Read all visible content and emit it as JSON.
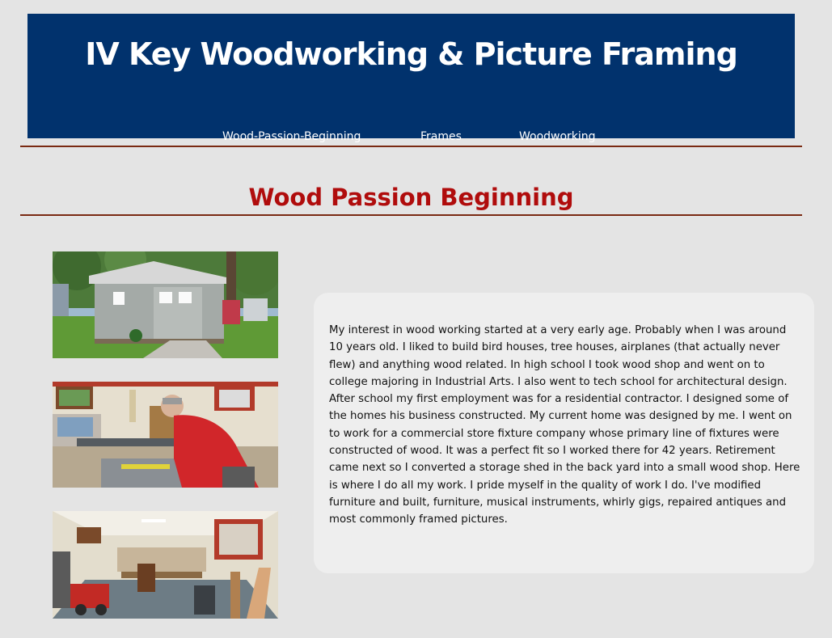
{
  "site": {
    "title": "IV Key Woodworking & Picture Framing"
  },
  "nav": {
    "items": [
      {
        "label": "Wood-Passion-Beginning"
      },
      {
        "label": "Frames"
      },
      {
        "label": "Woodworking"
      }
    ]
  },
  "page": {
    "title": "Wood Passion Beginning",
    "body": "My interest in wood working started at a very early age. Probably when I was around 10 years old. I liked to build bird houses, tree houses, airplanes (that actually never flew) and anything wood related. In high school I took wood shop and went on to college majoring in Industrial Arts. I also went to tech school for architectural design. After school my first employment was for a residential contractor. I designed some of the homes his business constructed. My current home was designed by me. I went on to work for a commercial store fixture company whose primary line of fixtures were constructed of wood. It was a perfect fit so I worked there for 42 years. Retirement came next so I converted a storage shed in the back yard into a small wood shop. Here is where I do all my work. I pride myself in the quality of work I do. I've modified furniture and built, furniture, musical instruments, whirly gigs, repaired antiques and most commonly framed pictures."
  },
  "colors": {
    "header_bg": "#01326d",
    "page_bg": "#e4e4e4",
    "title_red": "#b00c0c",
    "rule": "#7a2a12",
    "card_bg": "#eeeeee"
  },
  "photos": [
    {
      "name": "shed-exterior-photo"
    },
    {
      "name": "workbench-man-photo"
    },
    {
      "name": "shop-interior-photo"
    }
  ]
}
